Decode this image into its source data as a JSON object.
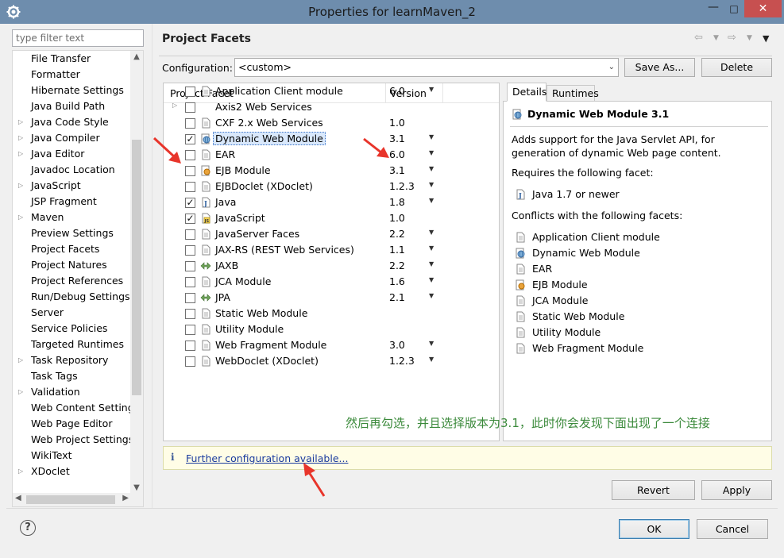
{
  "window": {
    "title": "Properties for learnMaven_2",
    "minimize": "—",
    "maximize": "□",
    "close": "✕"
  },
  "filter": {
    "placeholder": "type filter text"
  },
  "nav": {
    "items": [
      {
        "label": "File Transfer",
        "expandable": false
      },
      {
        "label": "Formatter",
        "expandable": false
      },
      {
        "label": "Hibernate Settings",
        "expandable": false
      },
      {
        "label": "Java Build Path",
        "expandable": false
      },
      {
        "label": "Java Code Style",
        "expandable": true
      },
      {
        "label": "Java Compiler",
        "expandable": true
      },
      {
        "label": "Java Editor",
        "expandable": true
      },
      {
        "label": "Javadoc Location",
        "expandable": false
      },
      {
        "label": "JavaScript",
        "expandable": true
      },
      {
        "label": "JSP Fragment",
        "expandable": false
      },
      {
        "label": "Maven",
        "expandable": true
      },
      {
        "label": "Preview Settings",
        "expandable": false
      },
      {
        "label": "Project Facets",
        "expandable": false,
        "selected": true
      },
      {
        "label": "Project Natures",
        "expandable": false
      },
      {
        "label": "Project References",
        "expandable": false
      },
      {
        "label": "Run/Debug Settings",
        "expandable": false
      },
      {
        "label": "Server",
        "expandable": false
      },
      {
        "label": "Service Policies",
        "expandable": false
      },
      {
        "label": "Targeted Runtimes",
        "expandable": false
      },
      {
        "label": "Task Repository",
        "expandable": true
      },
      {
        "label": "Task Tags",
        "expandable": false
      },
      {
        "label": "Validation",
        "expandable": true
      },
      {
        "label": "Web Content Settings",
        "expandable": false
      },
      {
        "label": "Web Page Editor",
        "expandable": false
      },
      {
        "label": "Web Project Settings",
        "expandable": false
      },
      {
        "label": "WikiText",
        "expandable": false
      },
      {
        "label": "XDoclet",
        "expandable": true
      }
    ]
  },
  "page": {
    "title": "Project Facets",
    "config_label": "Configuration:",
    "config_value": "<custom>",
    "save_as": "Save As...",
    "delete": "Delete"
  },
  "facets": {
    "col_facet": "Project Facet",
    "col_version": "Version",
    "rows": [
      {
        "name": "Application Client module",
        "version": "6.0",
        "checked": false,
        "dropdown": true,
        "icon": "doc-icon"
      },
      {
        "name": "Axis2 Web Services",
        "version": "",
        "checked": false,
        "dropdown": false,
        "icon": "none",
        "expandable": true
      },
      {
        "name": "CXF 2.x Web Services",
        "version": "1.0",
        "checked": false,
        "dropdown": false,
        "icon": "doc-icon"
      },
      {
        "name": "Dynamic Web Module",
        "version": "3.1",
        "checked": true,
        "dropdown": true,
        "icon": "globe-icon",
        "selected": true
      },
      {
        "name": "EAR",
        "version": "6.0",
        "checked": false,
        "dropdown": true,
        "icon": "doc-icon"
      },
      {
        "name": "EJB Module",
        "version": "3.1",
        "checked": false,
        "dropdown": true,
        "icon": "bean-icon"
      },
      {
        "name": "EJBDoclet (XDoclet)",
        "version": "1.2.3",
        "checked": false,
        "dropdown": true,
        "icon": "doc-icon"
      },
      {
        "name": "Java",
        "version": "1.8",
        "checked": true,
        "dropdown": true,
        "icon": "java-icon"
      },
      {
        "name": "JavaScript",
        "version": "1.0",
        "checked": true,
        "dropdown": false,
        "icon": "js-icon"
      },
      {
        "name": "JavaServer Faces",
        "version": "2.2",
        "checked": false,
        "dropdown": true,
        "icon": "doc-icon"
      },
      {
        "name": "JAX-RS (REST Web Services)",
        "version": "1.1",
        "checked": false,
        "dropdown": true,
        "icon": "doc-icon"
      },
      {
        "name": "JAXB",
        "version": "2.2",
        "checked": false,
        "dropdown": true,
        "icon": "arrows-icon"
      },
      {
        "name": "JCA Module",
        "version": "1.6",
        "checked": false,
        "dropdown": true,
        "icon": "doc-icon"
      },
      {
        "name": "JPA",
        "version": "2.1",
        "checked": false,
        "dropdown": true,
        "icon": "arrows-icon"
      },
      {
        "name": "Static Web Module",
        "version": "",
        "checked": false,
        "dropdown": false,
        "icon": "doc-icon"
      },
      {
        "name": "Utility Module",
        "version": "",
        "checked": false,
        "dropdown": false,
        "icon": "doc-icon"
      },
      {
        "name": "Web Fragment Module",
        "version": "3.0",
        "checked": false,
        "dropdown": true,
        "icon": "doc-icon"
      },
      {
        "name": "WebDoclet (XDoclet)",
        "version": "1.2.3",
        "checked": false,
        "dropdown": true,
        "icon": "doc-icon"
      }
    ]
  },
  "details": {
    "tab_details": "Details",
    "tab_runtimes": "Runtimes",
    "title": "Dynamic Web Module 3.1",
    "description": "Adds support for the Java Servlet API, for generation of dynamic Web page content.",
    "requires_label": "Requires the following facet:",
    "requires": [
      {
        "name": "Java 1.7 or newer",
        "icon": "java-icon"
      }
    ],
    "conflicts_label": "Conflicts with the following facets:",
    "conflicts": [
      {
        "name": "Application Client module",
        "icon": "doc-icon"
      },
      {
        "name": "Dynamic Web Module",
        "icon": "globe-icon"
      },
      {
        "name": "EAR",
        "icon": "doc-icon"
      },
      {
        "name": "EJB Module",
        "icon": "bean-icon"
      },
      {
        "name": "JCA Module",
        "icon": "doc-icon"
      },
      {
        "name": "Static Web Module",
        "icon": "doc-icon"
      },
      {
        "name": "Utility Module",
        "icon": "doc-icon"
      },
      {
        "name": "Web Fragment Module",
        "icon": "doc-icon"
      }
    ]
  },
  "annotation": "然后再勾选，并且选择版本为3.1，此时你会发现下面出现了一个连接",
  "info_bar": {
    "icon": "i",
    "link": "Further configuration available..."
  },
  "buttons": {
    "revert": "Revert",
    "apply": "Apply",
    "ok": "OK",
    "cancel": "Cancel",
    "help": "?"
  },
  "colors": {
    "titlebar": "#6e8dad",
    "close": "#c75050",
    "annotation": "#3b8a3b",
    "arrow": "#e8352b"
  }
}
